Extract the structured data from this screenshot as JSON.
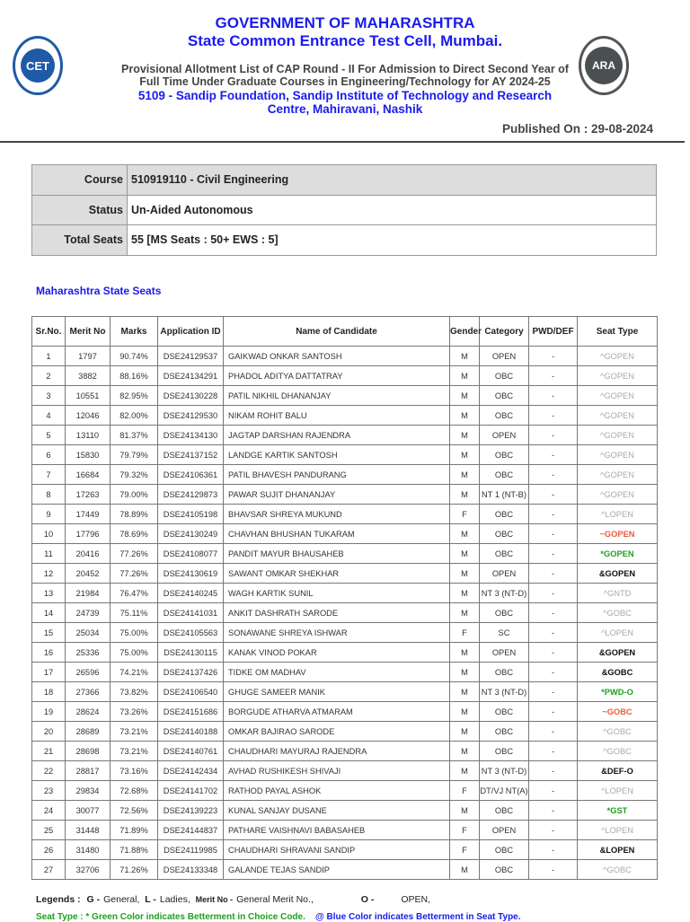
{
  "header": {
    "title": "GOVERNMENT OF MAHARASHTRA",
    "subtitle": "State Common Entrance Test Cell, Mumbai.",
    "line1": "Provisional Allotment List of CAP Round - II For Admission to Direct Second Year of",
    "line2": "Full Time Under Graduate Courses in Engineering/Technology for AY 2024-25",
    "institute1": "5109 - Sandip Foundation, Sandip Institute of Technology and Research",
    "institute2": "Centre, Mahiravani, Nashik",
    "published": "Published On : 29-08-2024",
    "logo_left": "CET",
    "logo_right": "ARA"
  },
  "info": [
    {
      "label": "Course",
      "value": "510919110 - Civil Engineering"
    },
    {
      "label": "Status",
      "value": "Un-Aided  Autonomous"
    },
    {
      "label": "Total Seats",
      "value": "55 [MS Seats : 50+ EWS : 5]"
    }
  ],
  "section_title": "Maharashtra State Seats",
  "columns": [
    "Sr.No.",
    "Merit No",
    "Marks",
    "Application ID",
    "Name of Candidate",
    "Gender",
    "Category",
    "PWD/DEF",
    "Seat Type"
  ],
  "seat_colors": {
    "gray": "#aaaaaa",
    "red": "#f05a3c",
    "green": "#1ea01e",
    "black": "#111111"
  },
  "rows": [
    [
      "1",
      "1797",
      "90.74%",
      "DSE24129537",
      "GAIKWAD ONKAR SANTOSH",
      "M",
      "OPEN",
      "-",
      "^GOPEN",
      "gray"
    ],
    [
      "2",
      "3882",
      "88.16%",
      "DSE24134291",
      "PHADOL ADITYA DATTATRAY",
      "M",
      "OBC",
      "-",
      "^GOPEN",
      "gray"
    ],
    [
      "3",
      "10551",
      "82.95%",
      "DSE24130228",
      "PATIL NIKHIL DHANANJAY",
      "M",
      "OBC",
      "-",
      "^GOPEN",
      "gray"
    ],
    [
      "4",
      "12046",
      "82.00%",
      "DSE24129530",
      "NIKAM ROHIT BALU",
      "M",
      "OBC",
      "-",
      "^GOPEN",
      "gray"
    ],
    [
      "5",
      "13110",
      "81.37%",
      "DSE24134130",
      "JAGTAP DARSHAN RAJENDRA",
      "M",
      "OPEN",
      "-",
      "^GOPEN",
      "gray"
    ],
    [
      "6",
      "15830",
      "79.79%",
      "DSE24137152",
      "LANDGE KARTIK SANTOSH",
      "M",
      "OBC",
      "-",
      "^GOPEN",
      "gray"
    ],
    [
      "7",
      "16684",
      "79.32%",
      "DSE24106361",
      "PATIL BHAVESH PANDURANG",
      "M",
      "OBC",
      "-",
      "^GOPEN",
      "gray"
    ],
    [
      "8",
      "17263",
      "79.00%",
      "DSE24129873",
      "PAWAR SUJIT DHANANJAY",
      "M",
      "NT 1 (NT-B)",
      "-",
      "^GOPEN",
      "gray"
    ],
    [
      "9",
      "17449",
      "78.89%",
      "DSE24105198",
      "BHAVSAR SHREYA MUKUND",
      "F",
      "OBC",
      "-",
      "^LOPEN",
      "gray"
    ],
    [
      "10",
      "17796",
      "78.69%",
      "DSE24130249",
      "CHAVHAN BHUSHAN TUKARAM",
      "M",
      "OBC",
      "-",
      "~GOPEN",
      "red"
    ],
    [
      "11",
      "20416",
      "77.26%",
      "DSE24108077",
      "PANDIT MAYUR BHAUSAHEB",
      "M",
      "OBC",
      "-",
      "*GOPEN",
      "green"
    ],
    [
      "12",
      "20452",
      "77.26%",
      "DSE24130619",
      "SAWANT OMKAR SHEKHAR",
      "M",
      "OPEN",
      "-",
      "&GOPEN",
      "black"
    ],
    [
      "13",
      "21984",
      "76.47%",
      "DSE24140245",
      "WAGH KARTIK SUNIL",
      "M",
      "NT 3 (NT-D)",
      "-",
      "^GNTD",
      "gray"
    ],
    [
      "14",
      "24739",
      "75.11%",
      "DSE24141031",
      "ANKIT DASHRATH SARODE",
      "M",
      "OBC",
      "-",
      "^GOBC",
      "gray"
    ],
    [
      "15",
      "25034",
      "75.00%",
      "DSE24105563",
      "SONAWANE SHREYA ISHWAR",
      "F",
      "SC",
      "-",
      "^LOPEN",
      "gray"
    ],
    [
      "16",
      "25336",
      "75.00%",
      "DSE24130115",
      "KANAK VINOD POKAR",
      "M",
      "OPEN",
      "-",
      "&GOPEN",
      "black"
    ],
    [
      "17",
      "26596",
      "74.21%",
      "DSE24137426",
      "TIDKE OM MADHAV",
      "M",
      "OBC",
      "-",
      "&GOBC",
      "black"
    ],
    [
      "18",
      "27366",
      "73.82%",
      "DSE24106540",
      "GHUGE SAMEER MANIK",
      "M",
      "NT 3 (NT-D)",
      "-",
      "*PWD-O",
      "green"
    ],
    [
      "19",
      "28624",
      "73.26%",
      "DSE24151686",
      "BORGUDE ATHARVA ATMARAM",
      "M",
      "OBC",
      "-",
      "~GOBC",
      "red"
    ],
    [
      "20",
      "28689",
      "73.21%",
      "DSE24140188",
      "OMKAR BAJIRAO SARODE",
      "M",
      "OBC",
      "-",
      "^GOBC",
      "gray"
    ],
    [
      "21",
      "28698",
      "73.21%",
      "DSE24140761",
      "CHAUDHARI MAYURAJ RAJENDRA",
      "M",
      "OBC",
      "-",
      "^GOBC",
      "gray"
    ],
    [
      "22",
      "28817",
      "73.16%",
      "DSE24142434",
      "AVHAD RUSHIKESH SHIVAJI",
      "M",
      "NT 3 (NT-D)",
      "-",
      "&DEF-O",
      "black"
    ],
    [
      "23",
      "29834",
      "72.68%",
      "DSE24141702",
      "RATHOD PAYAL ASHOK",
      "F",
      "DT/VJ NT(A)",
      "-",
      "^LOPEN",
      "gray"
    ],
    [
      "24",
      "30077",
      "72.56%",
      "DSE24139223",
      "KUNAL SANJAY DUSANE",
      "M",
      "OBC",
      "-",
      "*GST",
      "green"
    ],
    [
      "25",
      "31448",
      "71.89%",
      "DSE24144837",
      "PATHARE VAISHNAVI BABASAHEB",
      "F",
      "OPEN",
      "-",
      "^LOPEN",
      "gray"
    ],
    [
      "26",
      "31480",
      "71.88%",
      "DSE24119985",
      "CHAUDHARI SHRAVANI SANDIP",
      "F",
      "OBC",
      "-",
      "&LOPEN",
      "black"
    ],
    [
      "27",
      "32706",
      "71.26%",
      "DSE24133348",
      "GALANDE TEJAS SANDIP",
      "M",
      "OBC",
      "-",
      "^GOBC",
      "gray"
    ]
  ],
  "legend": {
    "label": "Legends :",
    "items": [
      "G -",
      "General,",
      "L -",
      "Ladies,",
      "Merit No -",
      "General Merit No.,",
      "O -",
      "OPEN,"
    ],
    "seat_type_green": "Seat Type : * Green Color indicates Betterment in Choice Code.",
    "seat_type_blue": "@ Blue Color indicates Betterment in Seat Type."
  }
}
